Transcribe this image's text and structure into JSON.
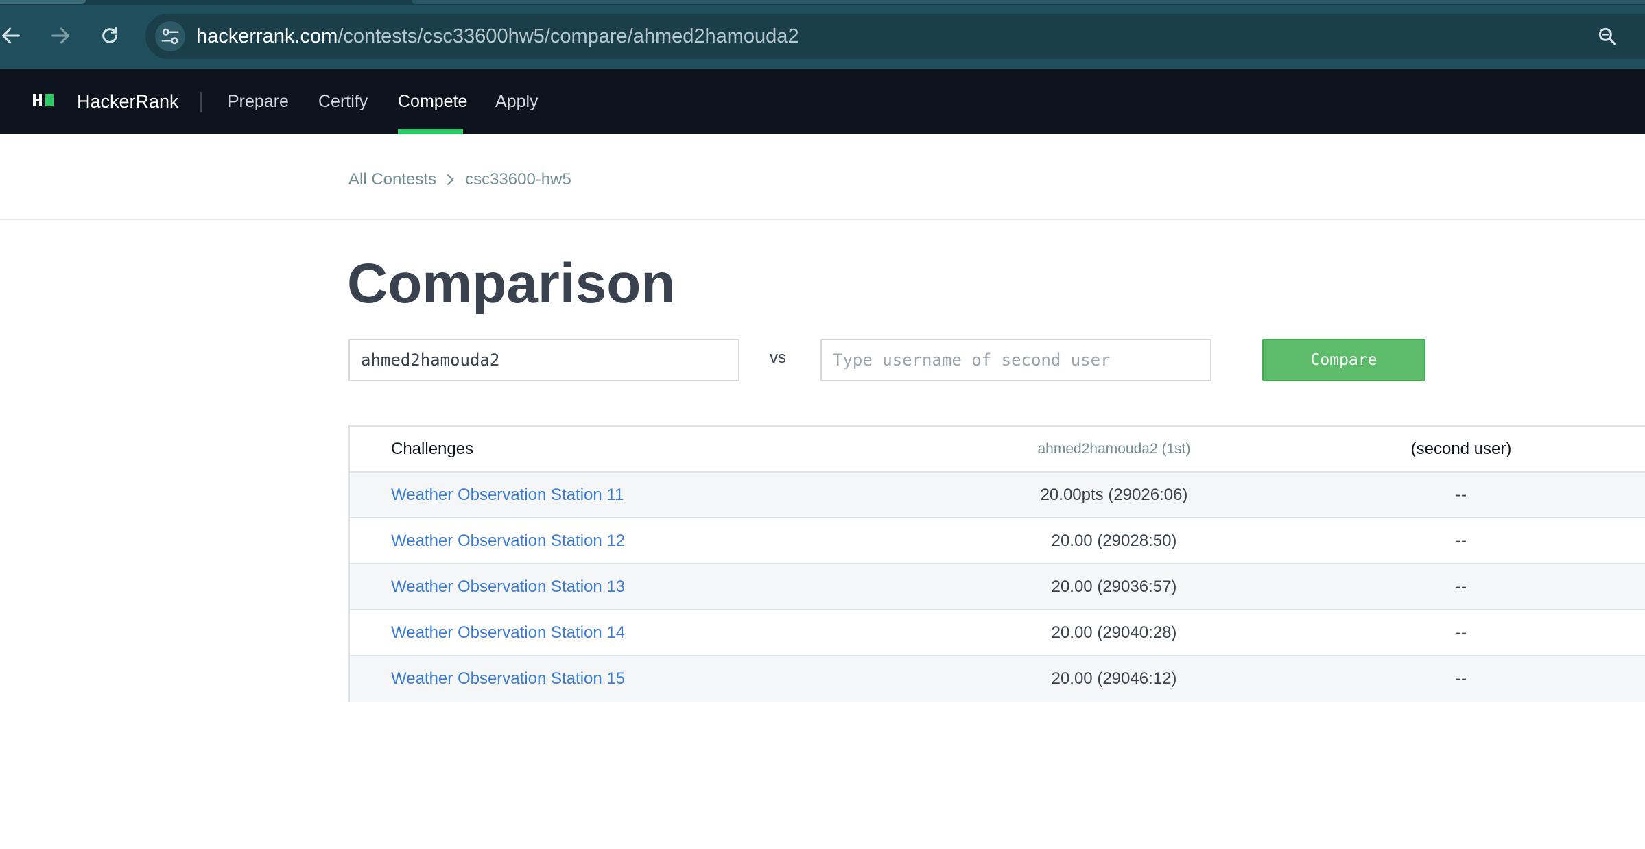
{
  "browser": {
    "url_host": "hackerrank.com",
    "url_path": "/contests/csc33600hw5/compare/ahmed2hamouda2",
    "icons": [
      "back-icon",
      "forward-icon",
      "reload-icon",
      "site-settings-icon",
      "zoom-icon"
    ]
  },
  "header": {
    "brand": "HackerRank",
    "nav": [
      {
        "label": "Prepare"
      },
      {
        "label": "Certify"
      },
      {
        "label": "Compete"
      },
      {
        "label": "Apply"
      }
    ],
    "active_nav": "Compete",
    "accent_color": "#2ec866"
  },
  "breadcrumb": {
    "items": [
      "All Contests",
      "csc33600-hw5"
    ]
  },
  "page": {
    "title": "Comparison"
  },
  "compare_form": {
    "first_user_value": "ahmed2hamouda2",
    "vs_label": "vs",
    "second_user_placeholder": "Type username of second user",
    "compare_button": "Compare"
  },
  "table": {
    "headers": {
      "challenges": "Challenges",
      "first_user": "ahmed2hamouda2 (1st)",
      "second_user": "(second user)"
    },
    "rows": [
      {
        "challenge": "Weather Observation Station 11",
        "score": "20.00pts (29026:06)",
        "second": "--"
      },
      {
        "challenge": "Weather Observation Station 12",
        "score": "20.00 (29028:50)",
        "second": "--"
      },
      {
        "challenge": "Weather Observation Station 13",
        "score": "20.00 (29036:57)",
        "second": "--"
      },
      {
        "challenge": "Weather Observation Station 14",
        "score": "20.00 (29040:28)",
        "second": "--"
      },
      {
        "challenge": "Weather Observation Station 15",
        "score": "20.00 (29046:12)",
        "second": "--"
      }
    ]
  }
}
